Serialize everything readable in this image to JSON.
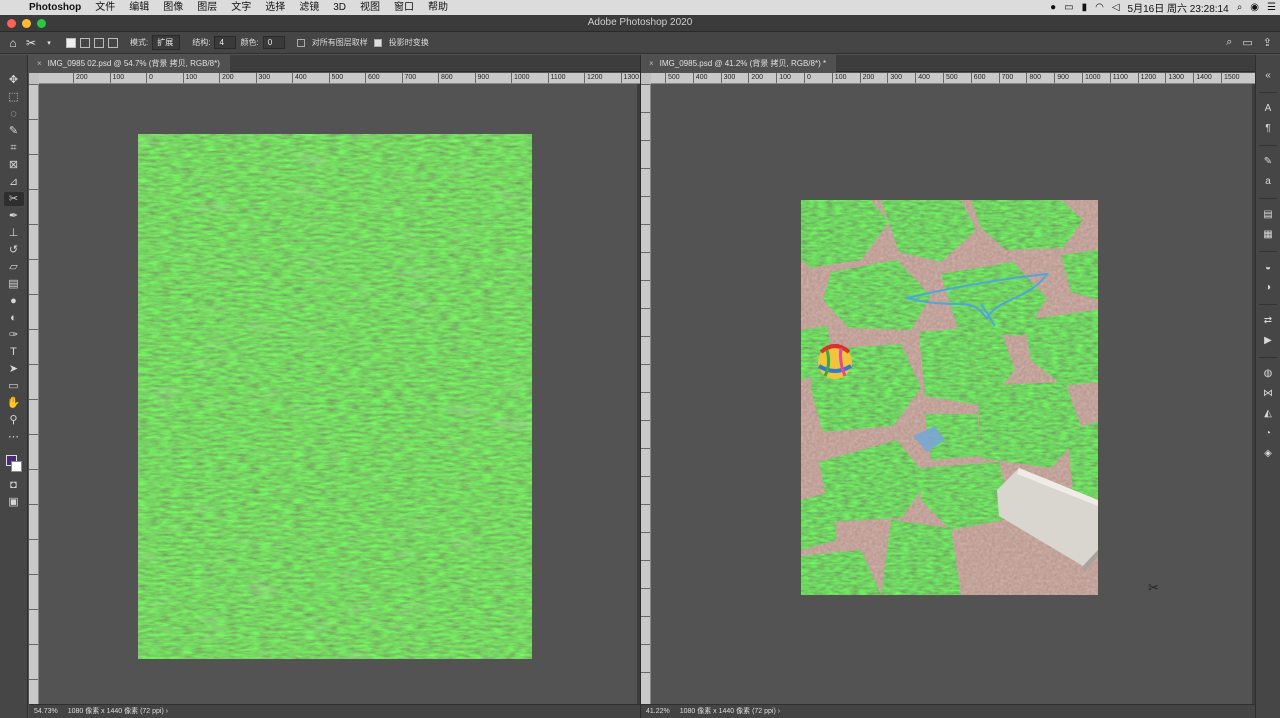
{
  "menubar": {
    "app_name": "Photoshop",
    "items": [
      "文件",
      "编辑",
      "图像",
      "图层",
      "文字",
      "选择",
      "滤镜",
      "3D",
      "视图",
      "窗口",
      "帮助"
    ],
    "datetime": "5月16日 周六 23:28:14"
  },
  "window": {
    "title": "Adobe Photoshop 2020"
  },
  "options": {
    "mode_label": "模式:",
    "mode_value": "扩展",
    "structure_label": "结构:",
    "structure_value": "4",
    "color_label": "颜色:",
    "color_value": "0",
    "sample_all_layers": "对所有图层取样",
    "transform_on_drop": "投影时变换"
  },
  "colors": {
    "foreground": "#4a2a7a",
    "background": "#ffffff"
  },
  "left_doc": {
    "tab_title": "IMG_0985 02.psd @ 54.7% (背景 拷贝, RGB/8*)",
    "zoom": "54.73%",
    "dimensions": "1080 像素 x 1440 像素 (72 ppi)",
    "ruler_labels": [
      "200",
      "100",
      "0",
      "100",
      "200",
      "300",
      "400",
      "500",
      "600",
      "700",
      "800",
      "900",
      "1000",
      "1100",
      "1200",
      "1300"
    ]
  },
  "right_doc": {
    "tab_title": "IMG_0985.psd @ 41.2% (背景 拷贝, RGB/8*) *",
    "zoom": "41.22%",
    "dimensions": "1080 像素 x 1440 像素 (72 ppi)",
    "ruler_labels": [
      "500",
      "400",
      "300",
      "200",
      "100",
      "0",
      "100",
      "200",
      "300",
      "400",
      "500",
      "600",
      "700",
      "800",
      "900",
      "1000",
      "1100",
      "1200",
      "1300",
      "1400",
      "1500"
    ]
  },
  "tools": [
    "move-icon",
    "marquee-icon",
    "lasso-icon",
    "quick-select-icon",
    "crop-icon",
    "frame-icon",
    "eyedropper-icon",
    "content-aware-move-icon",
    "brush-icon",
    "stamp-icon",
    "history-brush-icon",
    "eraser-icon",
    "gradient-icon",
    "blur-icon",
    "dodge-icon",
    "pen-icon",
    "type-icon",
    "path-select-icon",
    "rectangle-icon",
    "hand-icon",
    "zoom-icon",
    "more-icon"
  ]
}
